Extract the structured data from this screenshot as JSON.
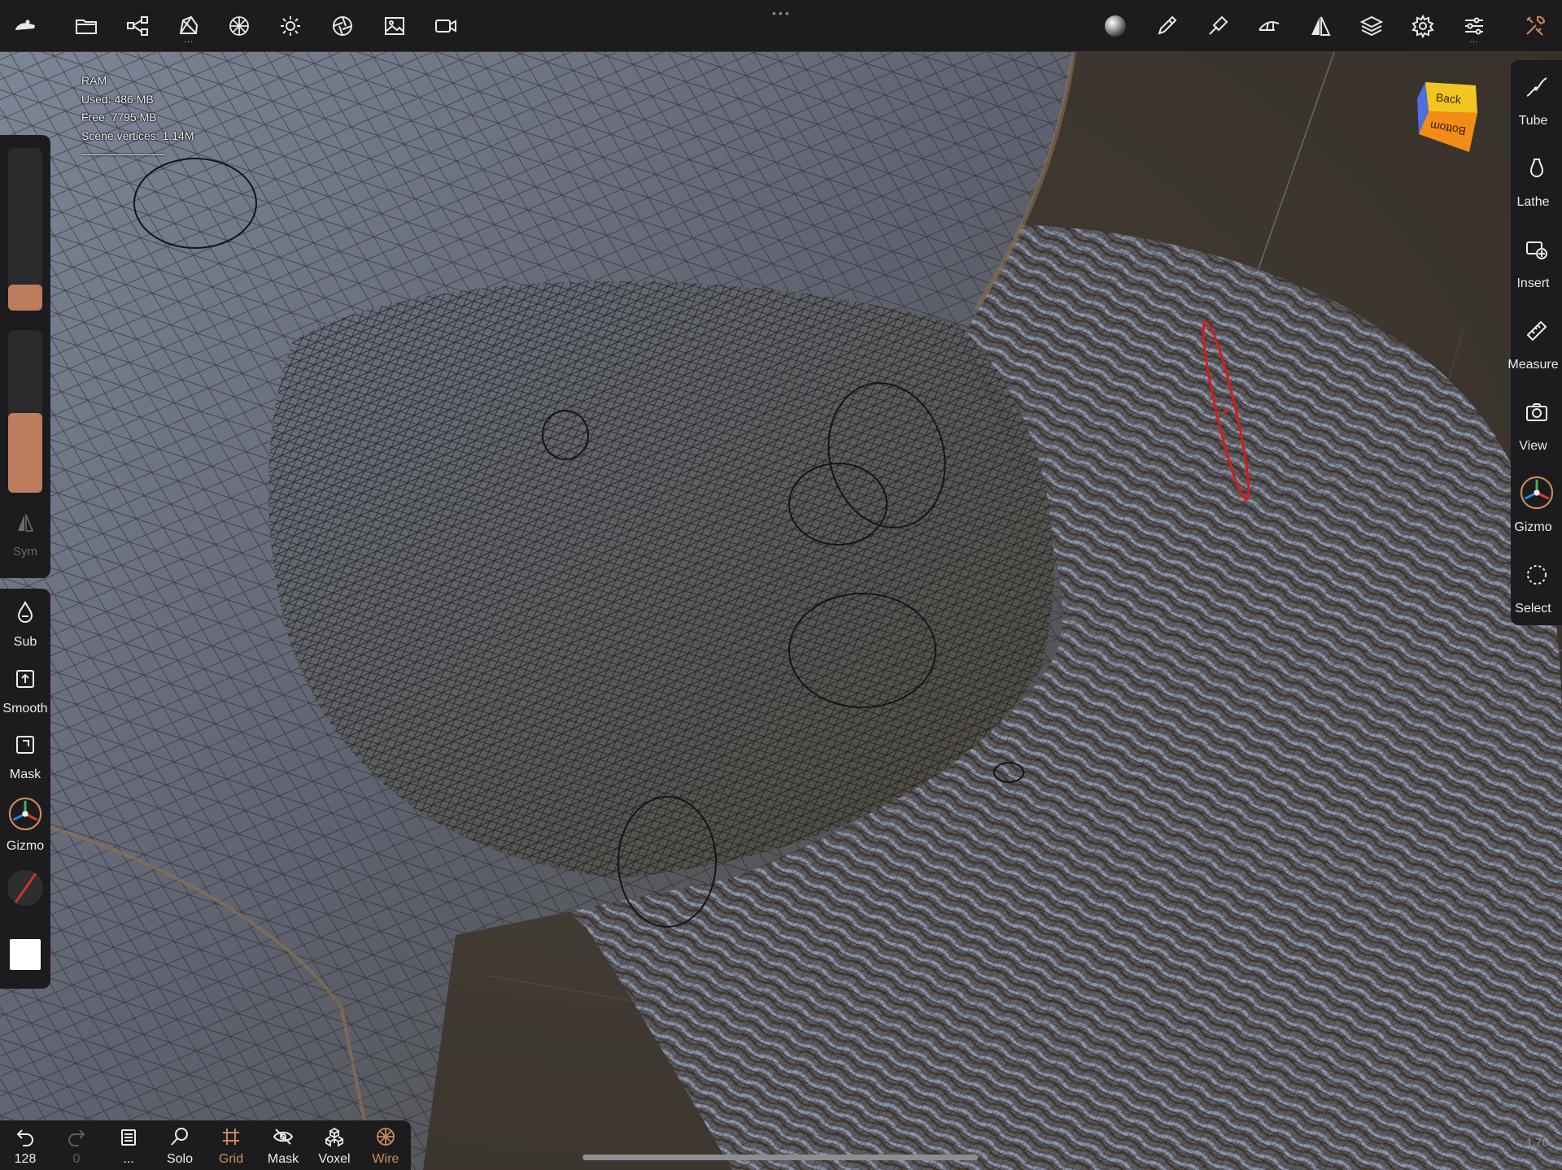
{
  "app": {
    "accent": "#c98a5e",
    "panel_bg": "#1c1c1e",
    "slider_color": "#bb7d5c"
  },
  "topbar": {
    "left_icons": [
      "scene-icon",
      "folder-icon",
      "share-icon",
      "mesh-icon",
      "material-icon",
      "light-icon",
      "camera-shutter-icon",
      "image-icon",
      "video-icon"
    ],
    "right_icons": [
      "matcap-sphere-icon",
      "brush-icon",
      "paint-icon",
      "tools-icon",
      "symmetry-icon",
      "layers-icon",
      "settings-icon",
      "sliders-icon",
      "wrench-icon"
    ],
    "more_dots": "..."
  },
  "stats": {
    "ram_label": "RAM",
    "used": "Used: 486 MB",
    "free": "Free: 7795 MB",
    "vertices": "Scene vertices: 1.14M",
    "separator": "----------------------------"
  },
  "left_panel": {
    "radius_slider": 0.16,
    "intensity_slider": 0.49,
    "sym_label": "Sym",
    "items": [
      {
        "id": "sub",
        "label": "Sub",
        "icon": "drop-icon"
      },
      {
        "id": "smooth",
        "label": "Smooth",
        "icon": "smooth-icon"
      },
      {
        "id": "mask",
        "label": "Mask",
        "icon": "mask-icon"
      },
      {
        "id": "gizmo",
        "label": "Gizmo",
        "icon": "gizmo-icon"
      }
    ]
  },
  "right_panel": {
    "items": [
      {
        "id": "tube",
        "label": "Tube",
        "icon": "tube-icon"
      },
      {
        "id": "lathe",
        "label": "Lathe",
        "icon": "lathe-icon"
      },
      {
        "id": "insert",
        "label": "Insert",
        "icon": "insert-icon"
      },
      {
        "id": "measure",
        "label": "Measure",
        "icon": "ruler-icon"
      },
      {
        "id": "view",
        "label": "View",
        "icon": "camera-icon"
      },
      {
        "id": "gizmo",
        "label": "Gizmo",
        "icon": "gizmo-icon"
      },
      {
        "id": "select",
        "label": "Select",
        "icon": "lasso-icon"
      }
    ]
  },
  "view_cube": {
    "top_face": "Back",
    "front_face": "Bottom"
  },
  "bottom_bar": {
    "items": [
      {
        "id": "undo",
        "label": "128",
        "icon": "undo-icon"
      },
      {
        "id": "redo",
        "label": "0",
        "icon": "redo-icon"
      },
      {
        "id": "layers",
        "label": "...",
        "icon": "layers-list-icon"
      },
      {
        "id": "solo",
        "label": "Solo",
        "icon": "solo-search-icon"
      },
      {
        "id": "grid",
        "label": "Grid",
        "icon": "grid-icon",
        "active": true
      },
      {
        "id": "mask",
        "label": "Mask",
        "icon": "eye-hidden-icon"
      },
      {
        "id": "voxel",
        "label": "Voxel",
        "icon": "voxel-icon"
      },
      {
        "id": "wire",
        "label": "Wire",
        "icon": "wire-icon",
        "active": true
      }
    ]
  },
  "version": "1.70"
}
